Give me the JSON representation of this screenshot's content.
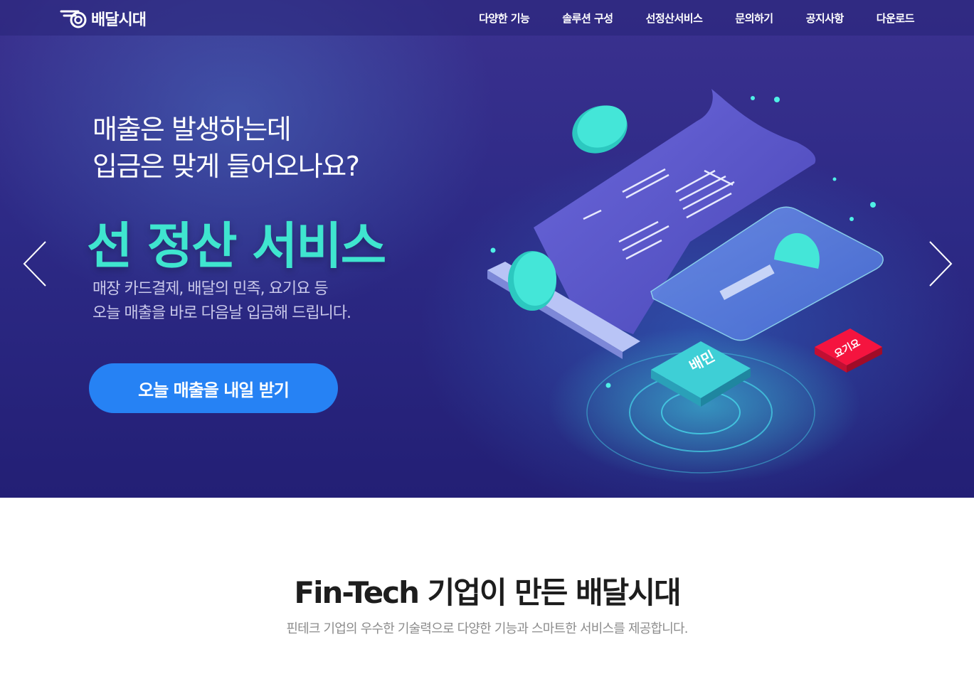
{
  "header": {
    "logo_text": "배달시대",
    "nav": [
      "다양한 기능",
      "솔루션 구성",
      "선정산서비스",
      "문의하기",
      "공지사항",
      "다운로드"
    ]
  },
  "hero": {
    "subtitle_lines": [
      "매출은 발생하는데",
      "입금은 맞게 들어오나요?"
    ],
    "title": "선 정산 서비스",
    "desc_lines": [
      "매장 카드결제, 배달의 민족, 요기요 등",
      "오늘 매출을 바로 다음날 입금해 드립니다."
    ],
    "cta_label": "오늘 매출을 내일 받기",
    "illustration": {
      "badge_baemin": "배민",
      "badge_yogiyo": "요기요"
    }
  },
  "intro": {
    "title": "Fin-Tech 기업이 만든 배달시대",
    "desc": "핀테크 기업의 우수한 기술력으로 다양한 기능과 스마트한 서비스를 제공합니다."
  },
  "colors": {
    "hero_bg": "#2d2a86",
    "accent_mint": "#3fe5cf",
    "cta_blue": "#2682f4",
    "yogiyo_red": "#f5143f"
  },
  "icons": {
    "logo": "bowl-swirl-logo-icon",
    "prev": "chevron-left-icon",
    "next": "chevron-right-icon"
  }
}
